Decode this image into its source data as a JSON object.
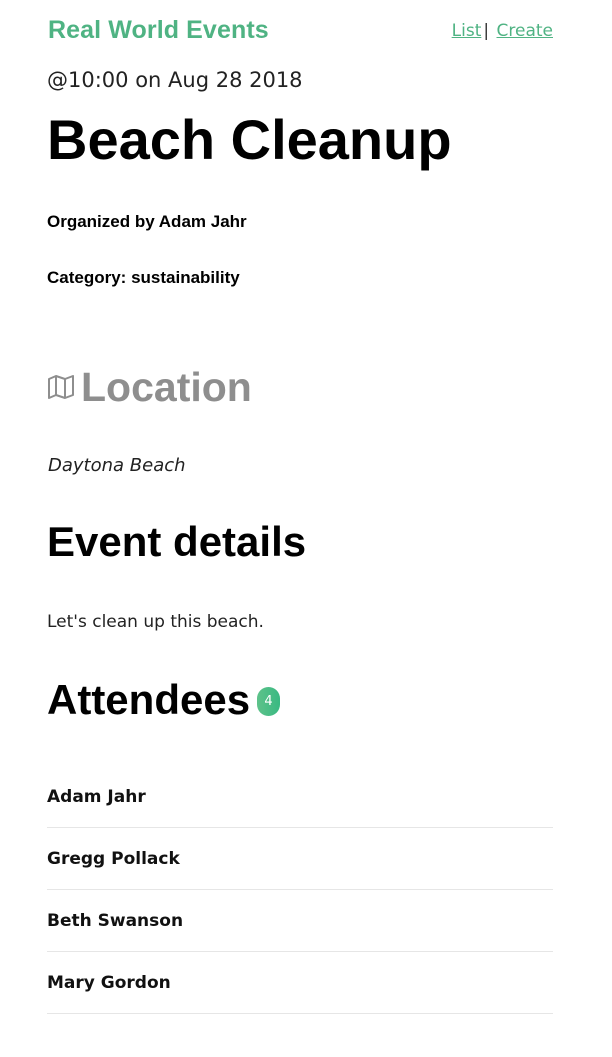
{
  "nav": {
    "brand": "Real World Events",
    "links": [
      {
        "label": "List"
      },
      {
        "label": "Create"
      }
    ],
    "separator": "|"
  },
  "event": {
    "datetime": "@10:00 on Aug 28 2018",
    "title": "Beach Cleanup",
    "organizer": "Organized by Adam Jahr",
    "category": "Category: sustainability"
  },
  "location": {
    "icon": "map-icon",
    "title": "Location",
    "address": "Daytona Beach"
  },
  "details": {
    "title": "Event details",
    "description": "Let's clean up this beach."
  },
  "attendees": {
    "title": "Attendees",
    "count": "4",
    "list": [
      {
        "name": "Adam Jahr"
      },
      {
        "name": "Gregg Pollack"
      },
      {
        "name": "Beth Swanson"
      },
      {
        "name": "Mary Gordon"
      }
    ]
  },
  "colors": {
    "brand": "#4fb383",
    "badge": "#39b982",
    "muted_heading": "#8e8e8e"
  }
}
